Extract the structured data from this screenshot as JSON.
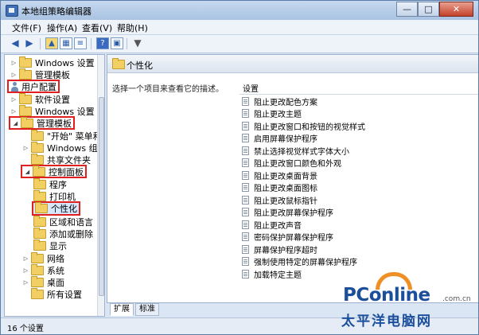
{
  "window": {
    "title": "本地组策略编辑器",
    "controls": {
      "minimize": "—",
      "maximize": "□",
      "close": "✕"
    }
  },
  "menu": {
    "items": [
      {
        "label": "文件(F)"
      },
      {
        "label": "操作(A)"
      },
      {
        "label": "查看(V)"
      },
      {
        "label": "帮助(H)"
      }
    ]
  },
  "toolbar": {
    "icons": [
      "back-arrow-icon",
      "forward-arrow-icon",
      "up-folder-icon",
      "show-hide-tree-icon",
      "properties-icon",
      "help-icon",
      "console-icon",
      "filter-icon"
    ]
  },
  "tree": {
    "items": [
      {
        "label": "Windows 设置",
        "icon": "folder"
      },
      {
        "label": "管理模板",
        "icon": "folder"
      },
      {
        "label": "用户配置",
        "icon": "user"
      },
      {
        "label": "软件设置",
        "icon": "folder"
      },
      {
        "label": "Windows 设置",
        "icon": "folder"
      },
      {
        "label": "管理模板",
        "icon": "folder"
      },
      {
        "label": "\"开始\" 菜单和",
        "icon": "folder"
      },
      {
        "label": "Windows 组件",
        "icon": "folder"
      },
      {
        "label": "共享文件夹",
        "icon": "folder"
      },
      {
        "label": "控制面板",
        "icon": "folder"
      },
      {
        "label": "程序",
        "icon": "folder"
      },
      {
        "label": "打印机",
        "icon": "folder"
      },
      {
        "label": "个性化",
        "icon": "folder"
      },
      {
        "label": "区域和语言",
        "icon": "folder"
      },
      {
        "label": "添加或删除",
        "icon": "folder"
      },
      {
        "label": "显示",
        "icon": "folder"
      },
      {
        "label": "网络",
        "icon": "folder"
      },
      {
        "label": "系统",
        "icon": "folder"
      },
      {
        "label": "桌面",
        "icon": "folder"
      },
      {
        "label": "所有设置",
        "icon": "folder"
      }
    ]
  },
  "right": {
    "header": "个性化",
    "description": "选择一个项目来查看它的描述。",
    "column": "设置",
    "settings": [
      "阻止更改配色方案",
      "阻止更改主题",
      "阻止更改窗口和按钮的视觉样式",
      "启用屏幕保护程序",
      "禁止选择视觉样式字体大小",
      "阻止更改窗口颜色和外观",
      "阻止更改桌面背景",
      "阻止更改桌面图标",
      "阻止更改鼠标指针",
      "阻止更改屏幕保护程序",
      "阻止更改声音",
      "密码保护屏幕保护程序",
      "屏幕保护程序超时",
      "强制使用特定的屏幕保护程序",
      "加载特定主题"
    ]
  },
  "tabs": [
    {
      "label": "扩展"
    },
    {
      "label": "标准"
    }
  ],
  "status": {
    "text": "16 个设置"
  },
  "watermark": {
    "brand": "PConline",
    "domain": ".com.cn",
    "chinese": "太平洋电脑网"
  }
}
